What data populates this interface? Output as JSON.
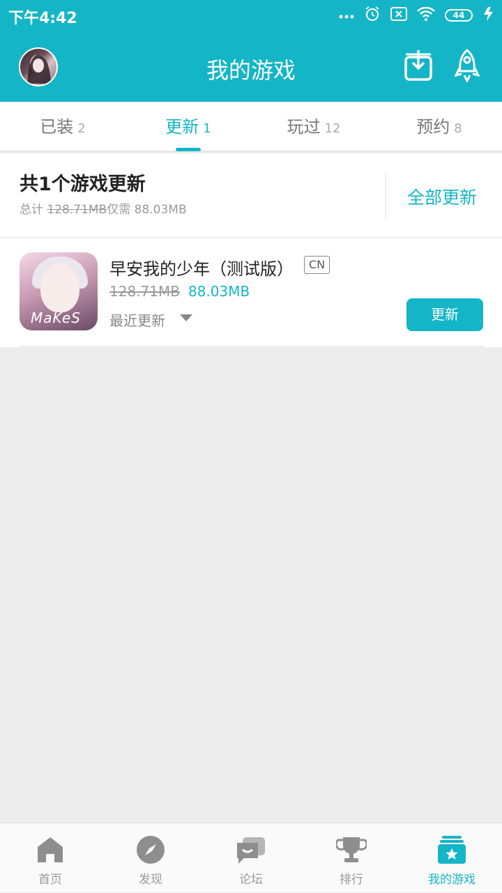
{
  "status_bar": {
    "time": "下午4:42",
    "battery": "44"
  },
  "header": {
    "title": "我的游戏"
  },
  "tabs": [
    {
      "label": "已装",
      "count": "2"
    },
    {
      "label": "更新",
      "count": "1"
    },
    {
      "label": "玩过",
      "count": "12"
    },
    {
      "label": "预约",
      "count": "8"
    }
  ],
  "summary": {
    "title": "共1个游戏更新",
    "total_label": "总计",
    "total_size": "128.71MB",
    "only_label": "仅需",
    "needed_size": "88.03MB",
    "update_all_label": "全部更新"
  },
  "game": {
    "name": "早安我的少年（测试版）",
    "region": "CN",
    "old_size": "128.71MB",
    "new_size": "88.03MB",
    "recent_label": "最近更新",
    "update_label": "更新",
    "icon_text": "MaKeS"
  },
  "bottom_nav": [
    {
      "label": "首页"
    },
    {
      "label": "发现"
    },
    {
      "label": "论坛"
    },
    {
      "label": "排行"
    },
    {
      "label": "我的游戏"
    }
  ],
  "colors": {
    "accent": "#14b5c6",
    "background": "#ececec"
  }
}
